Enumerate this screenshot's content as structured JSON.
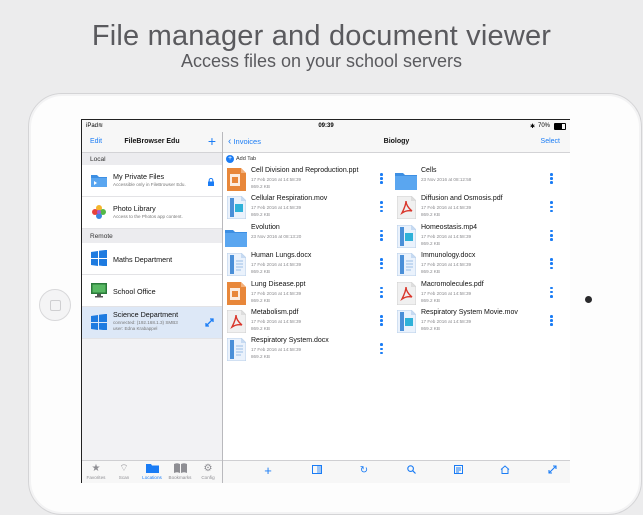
{
  "promo": {
    "headline": "File manager and document viewer",
    "subline": "Access files on your school servers"
  },
  "status": {
    "device": "iPad",
    "time": "09:39",
    "battery": "70%"
  },
  "sidebar": {
    "edit": "Edit",
    "title": "FileBrowser Edu",
    "add": "+",
    "local_header": "Local",
    "remote_header": "Remote",
    "local_items": [
      {
        "name": "My Private Files",
        "sub": "Accessible only in FileBrowser Edu.",
        "icon": "folder-icon",
        "trail": "lock-icon"
      },
      {
        "name": "Photo Library",
        "sub": "Access to the Photos app content.",
        "icon": "photos-icon"
      }
    ],
    "remote_items": [
      {
        "name": "Maths Department",
        "icon": "windows-server-icon"
      },
      {
        "name": "School Office",
        "icon": "monitor-icon"
      },
      {
        "name": "Science Department",
        "sub1": "connected: (192.168.1.3) SMB3",
        "sub2": "user: Edna Krabappel",
        "icon": "windows-server-icon",
        "trail": "expand-icon",
        "selected": true
      }
    ],
    "tabs": [
      {
        "label": "Favorites",
        "icon": "star-icon"
      },
      {
        "label": "Scan",
        "icon": "wifi-icon"
      },
      {
        "label": "Locations",
        "icon": "folder-icon",
        "active": true
      },
      {
        "label": "Bookmarks",
        "icon": "book-icon"
      },
      {
        "label": "Config",
        "icon": "gear-icon"
      }
    ]
  },
  "main": {
    "back": "Invoices",
    "title": "Biology",
    "select": "Select",
    "add_tab": "Add Tab",
    "files_left": [
      {
        "name": "Cell Division and Reproduction.ppt",
        "date": "17 Feb 2016 at 14:58:39",
        "size": "869.2 KB",
        "type": "ppt"
      },
      {
        "name": "Cellular Respiration.mov",
        "date": "17 Feb 2016 at 14:58:39",
        "size": "869.2 KB",
        "type": "mov"
      },
      {
        "name": "Evolution",
        "date": "23 Nov 2016 at 08:13:20",
        "size": "",
        "type": "folder"
      },
      {
        "name": "Human Lungs.docx",
        "date": "17 Feb 2016 at 14:58:39",
        "size": "869.2 KB",
        "type": "doc"
      },
      {
        "name": "Lung Disease.ppt",
        "date": "17 Feb 2016 at 14:58:39",
        "size": "869.2 KB",
        "type": "ppt"
      },
      {
        "name": "Metabolism.pdf",
        "date": "17 Feb 2016 at 14:58:39",
        "size": "869.2 KB",
        "type": "pdf"
      },
      {
        "name": "Respiratory System.docx",
        "date": "17 Feb 2016 at 14:58:39",
        "size": "869.2 KB",
        "type": "doc"
      }
    ],
    "files_right": [
      {
        "name": "Cells",
        "date": "23 Nov 2016 at 08:12:58",
        "size": "",
        "type": "folder"
      },
      {
        "name": "Diffusion and Osmosis.pdf",
        "date": "17 Feb 2016 at 14:58:39",
        "size": "869.2 KB",
        "type": "pdf"
      },
      {
        "name": "Homeostasis.mp4",
        "date": "17 Feb 2016 at 14:58:39",
        "size": "869.2 KB",
        "type": "mov"
      },
      {
        "name": "Immunology.docx",
        "date": "17 Feb 2016 at 14:58:39",
        "size": "869.2 KB",
        "type": "doc"
      },
      {
        "name": "Macromolecules.pdf",
        "date": "17 Feb 2016 at 14:58:39",
        "size": "869.2 KB",
        "type": "pdf"
      },
      {
        "name": "Respiratory System Movie.mov",
        "date": "17 Feb 2016 at 14:58:39",
        "size": "869.2 KB",
        "type": "mov"
      }
    ],
    "toolbar": [
      "add-icon",
      "split-view-icon",
      "refresh-icon",
      "search-icon",
      "filter-icon",
      "home-icon",
      "fullscreen-icon"
    ]
  },
  "colors": {
    "accent": "#1a7cf5",
    "ppt": "#e8873a",
    "pdf": "#d9362b",
    "doc": "#4a8fd8"
  }
}
